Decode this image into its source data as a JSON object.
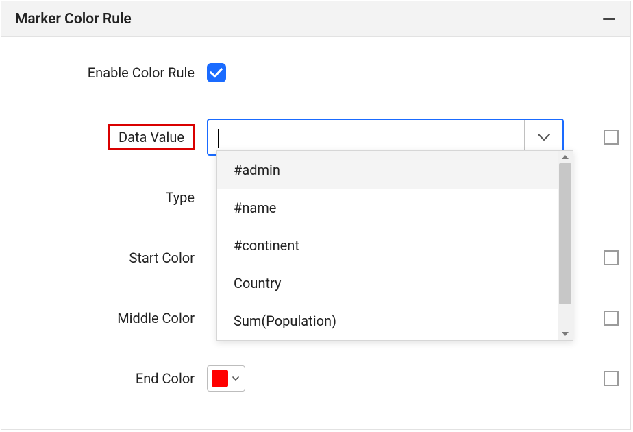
{
  "panel": {
    "title": "Marker Color Rule"
  },
  "rows": {
    "enable": {
      "label": "Enable Color Rule",
      "checked": true
    },
    "data_value": {
      "label": "Data Value",
      "value": ""
    },
    "type": {
      "label": "Type"
    },
    "start_color": {
      "label": "Start Color"
    },
    "middle_color": {
      "label": "Middle Color"
    },
    "end_color": {
      "label": "End Color",
      "value": "#ff0000"
    }
  },
  "dropdown": {
    "items": [
      "#admin",
      "#name",
      "#continent",
      "Country",
      "Sum(Population)"
    ]
  }
}
